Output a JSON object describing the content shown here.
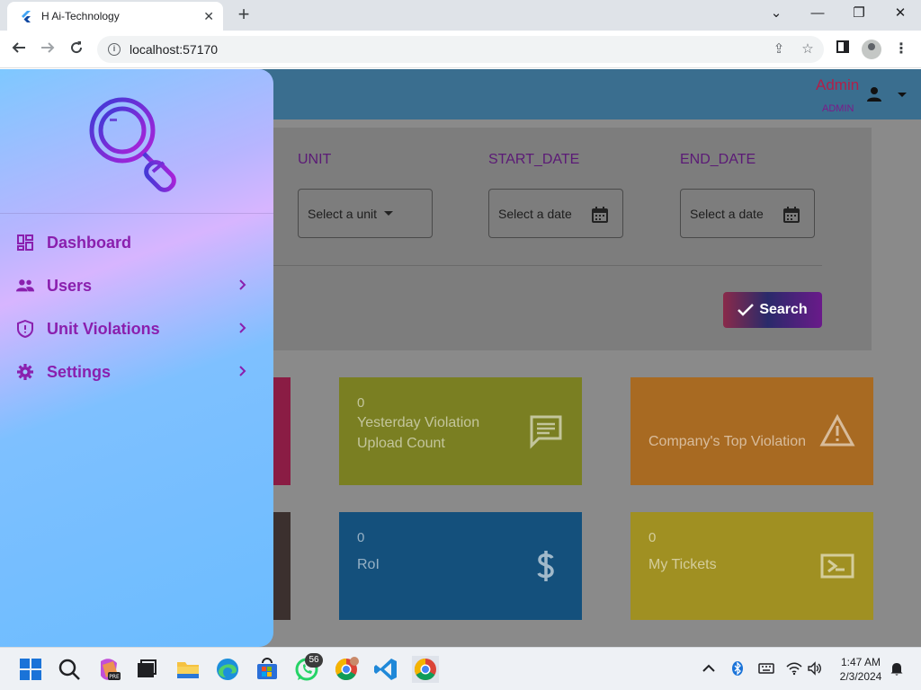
{
  "browser": {
    "tab_title": "H Ai-Technology",
    "tab_close": "✕",
    "new_tab": "+",
    "url": "localhost:57170",
    "window_controls": [
      "⌄",
      "—",
      "❐",
      "✕"
    ]
  },
  "app": {
    "user_name": "Admin",
    "user_role": "ADMIN"
  },
  "filters": {
    "unit_label": "UNIT",
    "unit_placeholder": "Select a unit",
    "start_label": "START_DATE",
    "start_placeholder": "Select a date",
    "end_label": "END_DATE",
    "end_placeholder": "Select a date",
    "search_label": "Search"
  },
  "cards": [
    {
      "value": "0",
      "label": "Yesterday Violation Upload Count",
      "color": "#7a7f22",
      "icon": "message-icon"
    },
    {
      "value": "",
      "label": "Company's Top Violation",
      "color": "#a86a22",
      "icon": "warning-icon"
    },
    {
      "value": "0",
      "label": "RoI",
      "color": "#14507c",
      "icon": "dollar-icon"
    },
    {
      "value": "0",
      "label": "My Tickets",
      "color": "#a09022",
      "icon": "ticket-icon"
    }
  ],
  "drawer": {
    "items": [
      {
        "label": "Dashboard",
        "icon": "dashboard-icon",
        "has_children": false
      },
      {
        "label": "Users",
        "icon": "users-icon",
        "has_children": true
      },
      {
        "label": "Unit Violations",
        "icon": "shield-icon",
        "has_children": true
      },
      {
        "label": "Settings",
        "icon": "gear-icon",
        "has_children": true
      }
    ]
  },
  "taskbar": {
    "whatsapp_badge": "56",
    "time": "1:47 AM",
    "date": "2/3/2024"
  },
  "colors": {
    "accent_purple": "#8a1fae",
    "appbar": "#3a6e8f"
  }
}
